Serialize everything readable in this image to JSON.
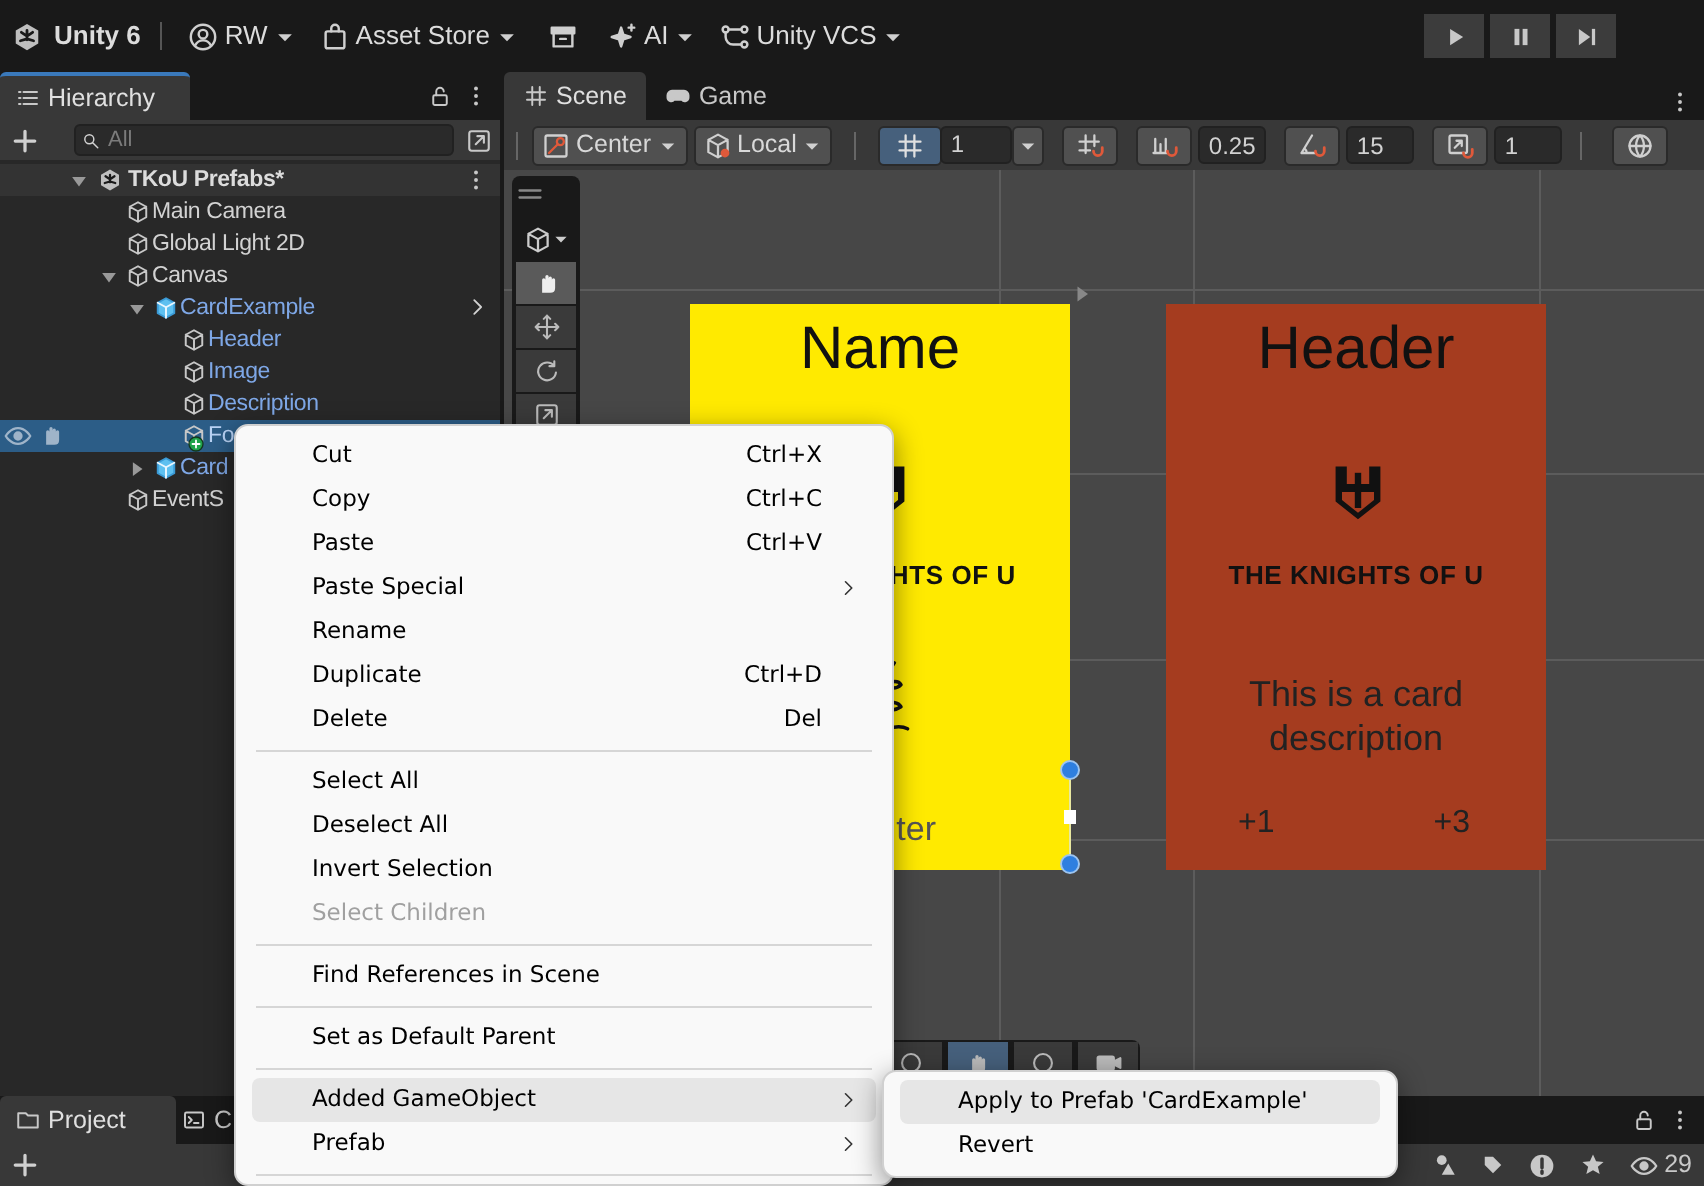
{
  "toolbar": {
    "product": "Unity 6",
    "account": "RW",
    "asset_store": "Asset Store",
    "ai": "AI",
    "version_control": "Unity VCS"
  },
  "hierarchy": {
    "title": "Hierarchy",
    "search": {
      "placeholder": "All"
    },
    "scene": {
      "name": "TKoU Prefabs*",
      "expanded": true
    },
    "items": [
      {
        "label": "Main Camera",
        "kind": "object",
        "selected": false,
        "added": false
      },
      {
        "label": "Global Light 2D",
        "kind": "object",
        "selected": false,
        "added": false
      },
      {
        "label": "Canvas",
        "kind": "object",
        "expanded": true,
        "selected": false,
        "added": false,
        "children": [
          {
            "label": "CardExample",
            "kind": "prefab",
            "expanded": true,
            "selected": false,
            "added": false,
            "children": [
              {
                "label": "Header",
                "kind": "prefab_part",
                "selected": false,
                "added": false
              },
              {
                "label": "Image",
                "kind": "prefab_part",
                "selected": false,
                "added": false
              },
              {
                "label": "Description",
                "kind": "prefab_part",
                "selected": false,
                "added": false
              },
              {
                "label": "Fo",
                "kind": "prefab_part",
                "selected": true,
                "added": true
              }
            ]
          },
          {
            "label": "Card",
            "kind": "prefab",
            "expanded": false,
            "selected": false,
            "added": false
          }
        ]
      },
      {
        "label": "EventS",
        "kind": "object",
        "selected": false,
        "added": false
      }
    ]
  },
  "scene_view": {
    "tabs": [
      {
        "label": "Scene",
        "kind": "scene",
        "selected": true
      },
      {
        "label": "Game",
        "kind": "game",
        "selected": false
      }
    ],
    "toolbar": {
      "pivot": "Center",
      "space": "Local",
      "grid_snapping": true,
      "grid_size": "1",
      "move_snap": "0.25",
      "rotate_snap": "15",
      "scale_snap": "1"
    },
    "cards": [
      {
        "color": "#ffea00",
        "title": "Name",
        "logo_text": "HTS OF U",
        "footer": "ter",
        "footer_selected": true
      },
      {
        "color": "#a53c1f",
        "title": "Header",
        "logo_text": "THE KNIGHTS OF U",
        "description": "This is a card description",
        "values": [
          "+1",
          "+3"
        ],
        "footer_selected": false
      }
    ]
  },
  "context_menu": {
    "items": [
      {
        "kind": "item",
        "label": "Cut",
        "shortcut": "Ctrl+X",
        "submenu": false,
        "disabled": false,
        "selected": false
      },
      {
        "kind": "item",
        "label": "Copy",
        "shortcut": "Ctrl+C",
        "submenu": false,
        "disabled": false,
        "selected": false
      },
      {
        "kind": "item",
        "label": "Paste",
        "shortcut": "Ctrl+V",
        "submenu": false,
        "disabled": false,
        "selected": false
      },
      {
        "kind": "item",
        "label": "Paste Special",
        "submenu": true,
        "disabled": false,
        "selected": false
      },
      {
        "kind": "item",
        "label": "Rename",
        "submenu": false,
        "disabled": false,
        "selected": false
      },
      {
        "kind": "item",
        "label": "Duplicate",
        "shortcut": "Ctrl+D",
        "submenu": false,
        "disabled": false,
        "selected": false
      },
      {
        "kind": "item",
        "label": "Delete",
        "shortcut": "Del",
        "submenu": false,
        "disabled": false,
        "selected": false
      },
      {
        "kind": "separator"
      },
      {
        "kind": "item",
        "label": "Select All",
        "submenu": false,
        "disabled": false,
        "selected": false
      },
      {
        "kind": "item",
        "label": "Deselect All",
        "submenu": false,
        "disabled": false,
        "selected": false
      },
      {
        "kind": "item",
        "label": "Invert Selection",
        "submenu": false,
        "disabled": false,
        "selected": false
      },
      {
        "kind": "item",
        "label": "Select Children",
        "submenu": false,
        "disabled": true,
        "selected": false
      },
      {
        "kind": "separator"
      },
      {
        "kind": "item",
        "label": "Find References in Scene",
        "submenu": false,
        "disabled": false,
        "selected": false
      },
      {
        "kind": "separator"
      },
      {
        "kind": "item",
        "label": "Set as Default Parent",
        "submenu": false,
        "disabled": false,
        "selected": false
      },
      {
        "kind": "separator"
      },
      {
        "kind": "item",
        "label": "Added GameObject",
        "submenu": true,
        "disabled": false,
        "selected": true
      },
      {
        "kind": "item",
        "label": "Prefab",
        "submenu": true,
        "disabled": false,
        "selected": false
      },
      {
        "kind": "separator"
      }
    ]
  },
  "submenu": {
    "items": [
      {
        "label": "Apply to Prefab 'CardExample'",
        "selected": true
      },
      {
        "label": "Revert",
        "selected": false
      }
    ]
  },
  "bottom_panel": {
    "tabs": [
      {
        "label": "Project",
        "kind": "project",
        "selected": true
      },
      {
        "label": "C",
        "kind": "console",
        "selected": false
      }
    ],
    "count": "29"
  }
}
